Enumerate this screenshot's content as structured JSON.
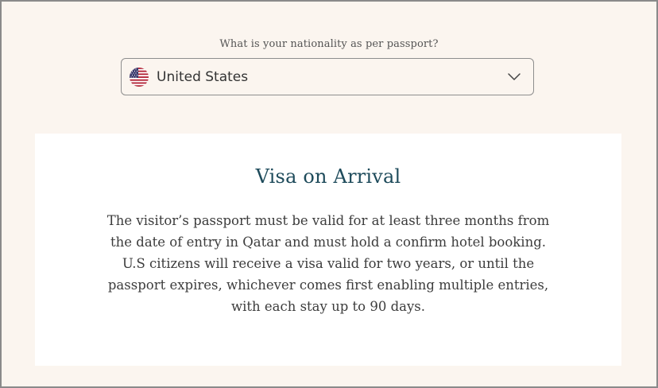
{
  "nationality": {
    "label": "What is your nationality as per passport?",
    "selected_country": "United States",
    "flag_icon": "us-flag-icon"
  },
  "visa_card": {
    "title": "Visa on Arrival",
    "paragraph_1": "The visitor’s passport must be valid for at least three months from the date of entry in Qatar and must hold a confirm hotel booking.",
    "paragraph_2": "U.S citizens will receive a visa valid for two years, or until the passport expires, whichever comes first enabling multiple entries, with each stay up to 90 days."
  },
  "colors": {
    "page_background": "#fbf5ef",
    "card_background": "#ffffff",
    "title_color": "#1e4b5b",
    "text_color": "#3c3c3c"
  }
}
